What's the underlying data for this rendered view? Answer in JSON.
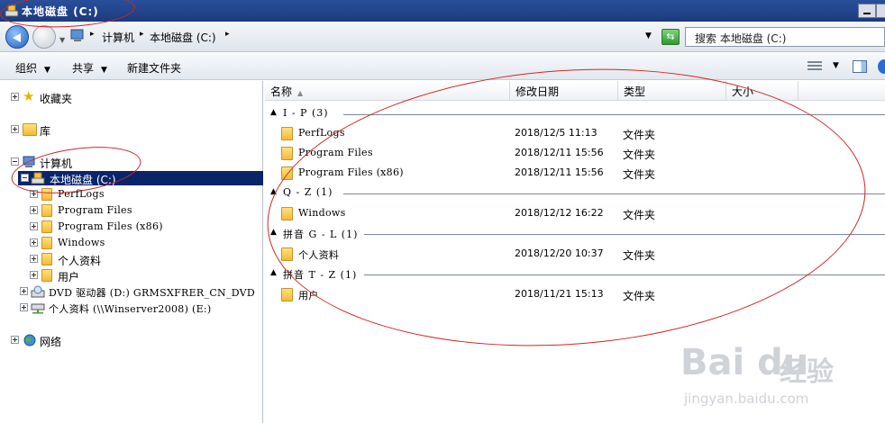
{
  "window": {
    "title": "本地磁盘 (C:)"
  },
  "address": {
    "crumbs": [
      "计算机",
      "本地磁盘 (C:)"
    ],
    "search_placeholder": "搜索 本地磁盘 (C:)"
  },
  "toolbar": {
    "organize_label": "组织",
    "share_label": "共享",
    "new_folder_label": "新建文件夹",
    "arrow": "▼"
  },
  "navpane": {
    "favorites": "收藏夹",
    "libraries": "库",
    "computer": "计算机",
    "local_disk": "本地磁盘 (C:)",
    "subfolders": [
      "PerfLogs",
      "Program Files",
      "Program Files (x86)",
      "Windows",
      "个人资料",
      "用户"
    ],
    "dvd_drive": "DVD 驱动器 (D:) GRMSXFRER_CN_DVD",
    "network_drive": "个人资料 (\\\\Winserver2008) (E:)",
    "network": "网络"
  },
  "filelist": {
    "columns": {
      "name": "名称",
      "modified": "修改日期",
      "type": "类型",
      "size": "大小"
    },
    "groups": [
      {
        "label": "I - P (3)",
        "items": [
          {
            "name": "PerfLogs",
            "modified": "2018/12/5 11:13",
            "type": "文件夹"
          },
          {
            "name": "Program Files",
            "modified": "2018/12/11 15:56",
            "type": "文件夹"
          },
          {
            "name": "Program Files (x86)",
            "modified": "2018/12/11 15:56",
            "type": "文件夹"
          }
        ]
      },
      {
        "label": "Q - Z (1)",
        "items": [
          {
            "name": "Windows",
            "modified": "2018/12/12 16:22",
            "type": "文件夹"
          }
        ]
      },
      {
        "label": "拼音 G - L (1)",
        "items": [
          {
            "name": "个人资料",
            "modified": "2018/12/20 10:37",
            "type": "文件夹"
          }
        ]
      },
      {
        "label": "拼音 T - Z (1)",
        "items": [
          {
            "name": "用户",
            "modified": "2018/11/21 15:13",
            "type": "文件夹"
          }
        ]
      }
    ]
  },
  "watermark": {
    "logo": "Bai du",
    "cn": "经验",
    "url": "jingyan.baidu.com"
  },
  "colors": {
    "selection": "#0a246a",
    "annotation": "#d2261f",
    "titlebar": "#1c3a7e"
  },
  "icons": {
    "titlebar": "drive-icon",
    "back": "back-arrow-icon",
    "forward": "forward-arrow-icon",
    "refresh": "refresh-icon",
    "favorites": "star-icon",
    "libraries": "library-icon",
    "computer": "computer-icon",
    "network": "network-icon",
    "folder": "folder-icon"
  }
}
